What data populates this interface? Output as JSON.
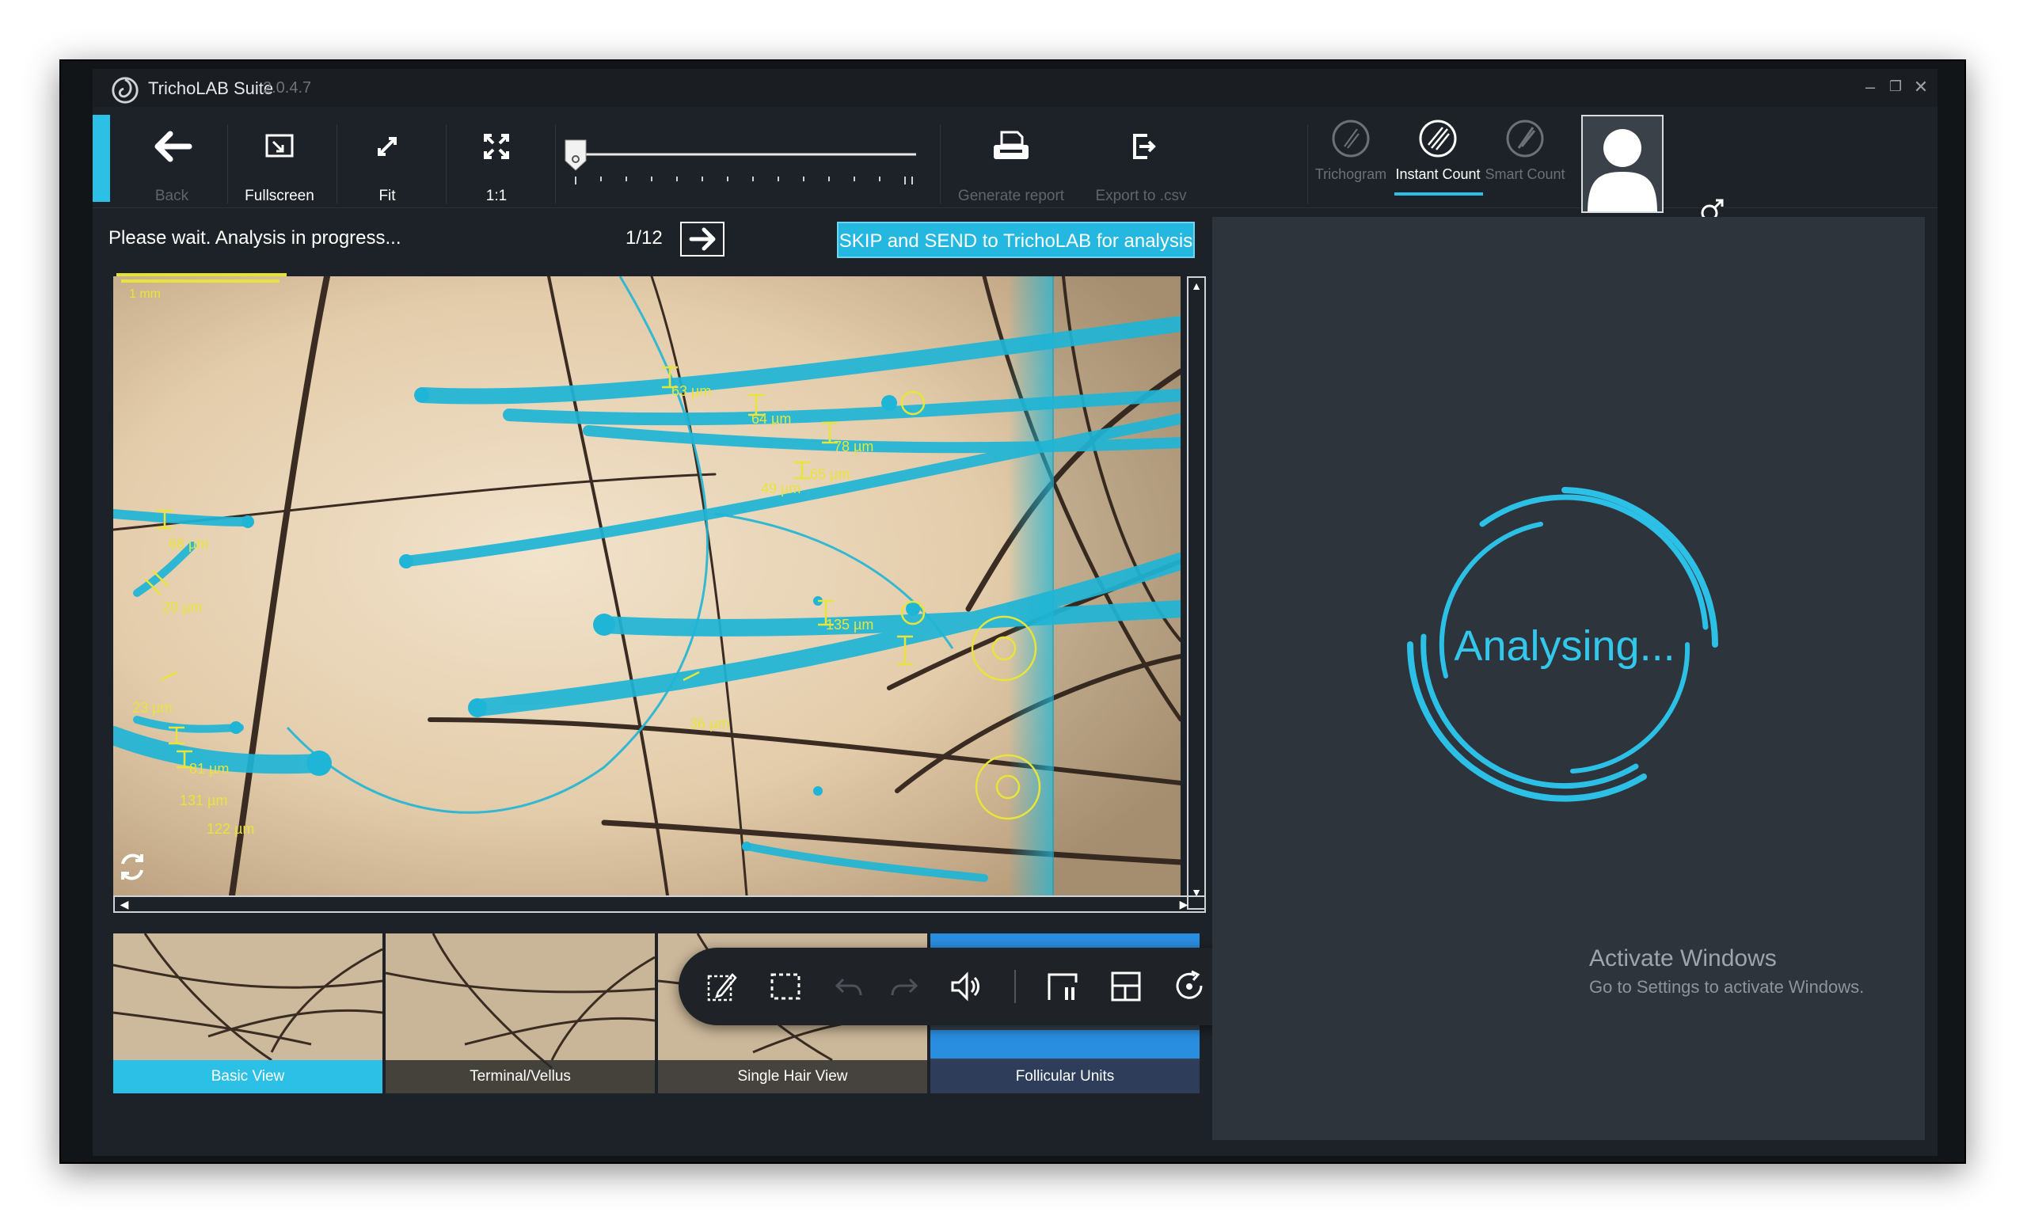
{
  "window": {
    "title": "TrichoLAB Suite",
    "version": "2.0.4.7",
    "controls": {
      "minimize": "–",
      "restore": "❐",
      "close": "✕"
    }
  },
  "toolbar": {
    "back_label": "Back",
    "fullscreen_label": "Fullscreen",
    "fit_label": "Fit",
    "one_to_one_label": "1:1",
    "generate_report_label": "Generate report",
    "export_csv_label": "Export to .csv",
    "zoom_level": 0
  },
  "modes": {
    "trichogram_label": "Trichogram",
    "instant_count_label": "Instant Count",
    "smart_count_label": "Smart Count",
    "active": "Instant Count"
  },
  "status": {
    "message": "Please wait. Analysis in progress...",
    "page_counter": "1/12",
    "skip_button_label": "SKIP and SEND to TrichoLAB for analysis"
  },
  "image": {
    "scale_label": "1 mm",
    "measurements": [
      "63 µm",
      "64 µm",
      "78 µm",
      "65 µm",
      "49 µm",
      "68 µm",
      "20 µm",
      "135 µm",
      "23 µm",
      "36 µm",
      "81 µm",
      "131 µm",
      "122 µm"
    ]
  },
  "views": [
    {
      "label": "Basic View",
      "active": true
    },
    {
      "label": "Terminal/Vellus",
      "active": false
    },
    {
      "label": "Single Hair View",
      "active": false
    },
    {
      "label": "Follicular Units",
      "active": false
    }
  ],
  "analysis": {
    "status_text": "Analysing..."
  },
  "watermark": {
    "title": "Activate Windows",
    "subtitle": "Go to Settings to activate Windows."
  },
  "colors": {
    "accent": "#2cc0e6",
    "hair_overlay": "#1fb5d6",
    "measure": "#e8e43a"
  }
}
